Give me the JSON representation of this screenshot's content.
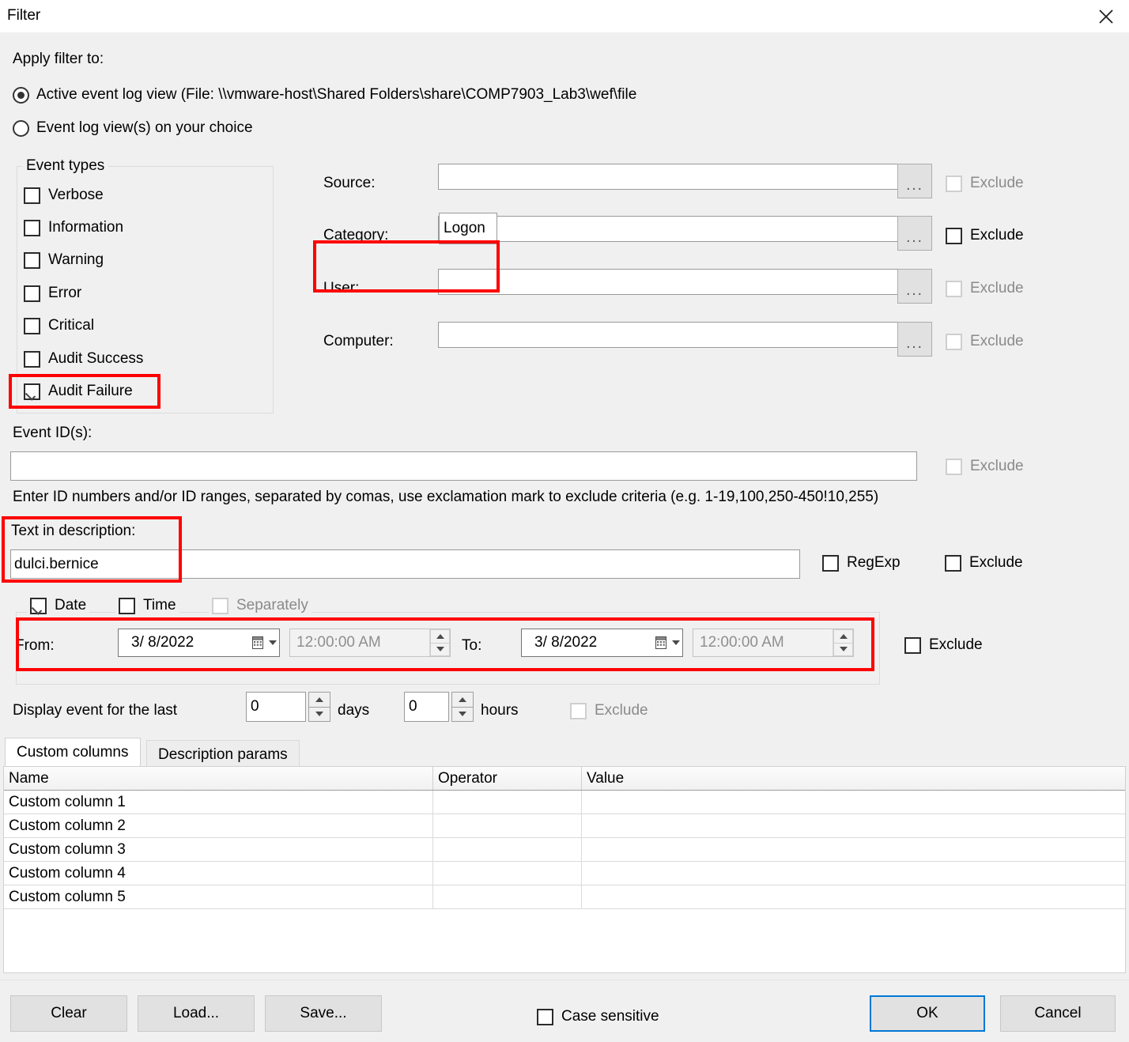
{
  "window": {
    "title": "Filter",
    "close_icon": "close-icon"
  },
  "apply_filter": {
    "label": "Apply filter to:",
    "options": [
      {
        "label": "Active event log view (File: \\\\vmware-host\\Shared Folders\\share\\COMP7903_Lab3\\wef\\file",
        "selected": true
      },
      {
        "label": "Event log view(s) on your choice",
        "selected": false
      }
    ]
  },
  "event_types": {
    "title": "Event types",
    "items": [
      {
        "label": "Verbose",
        "checked": false
      },
      {
        "label": "Information",
        "checked": false
      },
      {
        "label": "Warning",
        "checked": false
      },
      {
        "label": "Error",
        "checked": false
      },
      {
        "label": "Critical",
        "checked": false
      },
      {
        "label": "Audit Success",
        "checked": false
      },
      {
        "label": "Audit Failure",
        "checked": true
      }
    ]
  },
  "criteria": {
    "exclude_label": "Exclude",
    "browse_label": "...",
    "rows": [
      {
        "label": "Source:",
        "value": "",
        "exclude": false,
        "enabled": false
      },
      {
        "label": "Category:",
        "value": "",
        "exclude": false,
        "enabled": true,
        "suggestion": "Logon"
      },
      {
        "label": "User:",
        "value": "",
        "exclude": false,
        "enabled": false
      },
      {
        "label": "Computer:",
        "value": "",
        "exclude": false,
        "enabled": false
      }
    ]
  },
  "event_ids": {
    "label": "Event ID(s):",
    "value": "",
    "exclude_label": "Exclude",
    "hint": "Enter ID numbers and/or ID ranges, separated by comas, use exclamation mark to exclude criteria (e.g. 1-19,100,250-450!10,255)"
  },
  "text_in_description": {
    "label": "Text in description:",
    "value": "dulci.bernice",
    "regexp_label": "RegExp",
    "regexp_checked": false,
    "exclude_label": "Exclude",
    "exclude_checked": false
  },
  "date_group": {
    "date_label": "Date",
    "date_checked": true,
    "time_label": "Time",
    "time_checked": false,
    "separately_label": "Separately",
    "separately_checked": false,
    "from_label": "From:",
    "from_date": "3/  8/2022",
    "from_time": "12:00:00 AM",
    "to_label": "To:",
    "to_date": "3/  8/2022",
    "to_time": "12:00:00 AM",
    "exclude_label": "Exclude",
    "exclude_checked": false
  },
  "display_last": {
    "label": "Display event for the last",
    "days_value": "0",
    "days_label": "days",
    "hours_value": "0",
    "hours_label": "hours",
    "exclude_label": "Exclude",
    "exclude_checked": false
  },
  "tabs": [
    {
      "label": "Custom columns",
      "active": true
    },
    {
      "label": "Description params",
      "active": false
    }
  ],
  "table": {
    "columns": [
      "Name",
      "Operator",
      "Value"
    ],
    "rows": [
      {
        "name": "Custom column 1",
        "operator": "",
        "value": ""
      },
      {
        "name": "Custom column 2",
        "operator": "",
        "value": ""
      },
      {
        "name": "Custom column 3",
        "operator": "",
        "value": ""
      },
      {
        "name": "Custom column 4",
        "operator": "",
        "value": ""
      },
      {
        "name": "Custom column 5",
        "operator": "",
        "value": ""
      }
    ]
  },
  "footer": {
    "clear_label": "Clear",
    "load_label": "Load...",
    "save_label": "Save...",
    "case_sensitive_label": "Case sensitive",
    "case_sensitive_checked": false,
    "ok_label": "OK",
    "cancel_label": "Cancel"
  },
  "colors": {
    "highlight": "#ff0000",
    "accent": "#0078d7",
    "window_bg": "#f0f0f0",
    "field_bg": "#ffffff"
  }
}
